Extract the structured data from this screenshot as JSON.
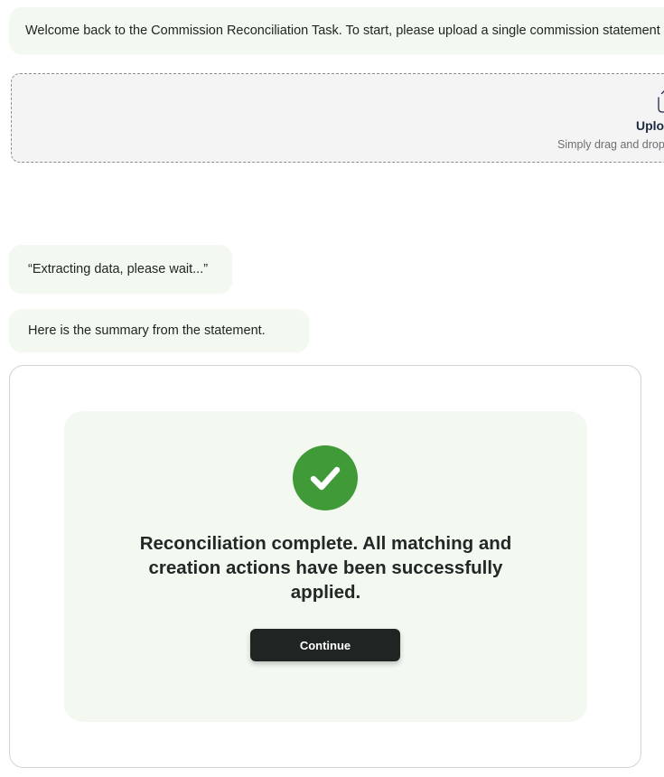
{
  "chat": {
    "welcome_message": "Welcome back to the Commission Reconciliation Task. To start, please upload a single commission statement",
    "extracting_message": "“Extracting data, please wait...”",
    "summary_intro": "Here is the summary from the statement."
  },
  "upload": {
    "icon": "upload-icon",
    "title": "Upload",
    "subtitle": "Simply drag and drop"
  },
  "result": {
    "icon": "check-circle-icon",
    "message": "Reconciliation complete. All matching and creation actions have been successfully applied.",
    "continue_label": "Continue"
  },
  "colors": {
    "message_bg": "#f3f8f1",
    "success_green": "#3f9a37",
    "button_dark": "#1f2522",
    "dropzone_bg": "#f4f4f4"
  }
}
